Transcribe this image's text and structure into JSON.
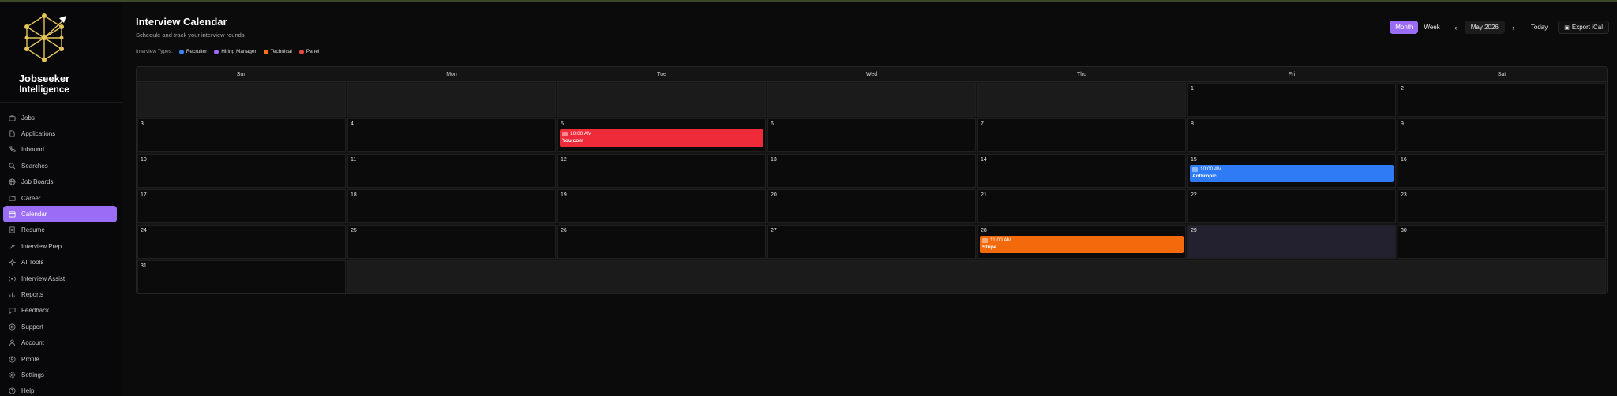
{
  "app": {
    "name_line1": "Jobseeker",
    "name_line2": "Intelligence"
  },
  "sidebar": {
    "items": [
      {
        "label": "Jobs",
        "icon": "briefcase-icon",
        "active": false
      },
      {
        "label": "Applications",
        "icon": "file-icon",
        "active": false
      },
      {
        "label": "Inbound",
        "icon": "phone-icon",
        "active": false
      },
      {
        "label": "Searches",
        "icon": "search-icon",
        "active": false
      },
      {
        "label": "Job Boards",
        "icon": "globe-icon",
        "active": false
      },
      {
        "label": "Career",
        "icon": "folder-icon",
        "active": false
      },
      {
        "label": "Calendar",
        "icon": "calendar-icon",
        "active": true
      },
      {
        "label": "Resume",
        "icon": "document-icon",
        "active": false
      },
      {
        "label": "Interview Prep",
        "icon": "tool-icon",
        "active": false
      },
      {
        "label": "AI Tools",
        "icon": "sparkle-icon",
        "active": false
      },
      {
        "label": "Interview Assist",
        "icon": "radio-icon",
        "active": false
      },
      {
        "label": "Reports",
        "icon": "chart-icon",
        "active": false
      },
      {
        "label": "Feedback",
        "icon": "message-icon",
        "active": false
      },
      {
        "label": "Support",
        "icon": "lifebuoy-icon",
        "active": false
      },
      {
        "label": "Account",
        "icon": "user-icon",
        "active": false
      },
      {
        "label": "Profile",
        "icon": "user-circle-icon",
        "active": false
      },
      {
        "label": "Settings",
        "icon": "gear-icon",
        "active": false
      },
      {
        "label": "Help",
        "icon": "help-icon",
        "active": false
      }
    ]
  },
  "header": {
    "title": "Interview Calendar",
    "subtitle": "Schedule and track your interview rounds"
  },
  "legend": {
    "label": "Interview Types:",
    "items": [
      {
        "label": "Recruiter",
        "color": "#3b82f6"
      },
      {
        "label": "Hiring Manager",
        "color": "#9b6cf6"
      },
      {
        "label": "Technical",
        "color": "#f97316"
      },
      {
        "label": "Panel",
        "color": "#ef4444"
      }
    ]
  },
  "toolbar": {
    "month_label": "Month",
    "week_label": "Week",
    "prev_icon": "chevron-left-icon",
    "next_icon": "chevron-right-icon",
    "current_period": "May 2026",
    "today_label": "Today",
    "export_label": "Export iCal",
    "export_icon": "calendar-icon"
  },
  "calendar": {
    "weekdays": [
      "Sun",
      "Mon",
      "Tue",
      "Wed",
      "Thu",
      "Fri",
      "Sat"
    ],
    "leading_empty_days": 5,
    "days_in_month": 31,
    "selected_day": 29,
    "events": [
      {
        "day": 5,
        "time": "10:00 AM",
        "company": "You.com",
        "type": "Panel",
        "color": "#ef2b3a"
      },
      {
        "day": 15,
        "time": "10:00 AM",
        "company": "Anthropic",
        "type": "Recruiter",
        "color": "#2f7af5"
      },
      {
        "day": 28,
        "time": "11:00 AM",
        "company": "Stripe",
        "type": "Technical",
        "color": "#f26a0c"
      }
    ]
  }
}
